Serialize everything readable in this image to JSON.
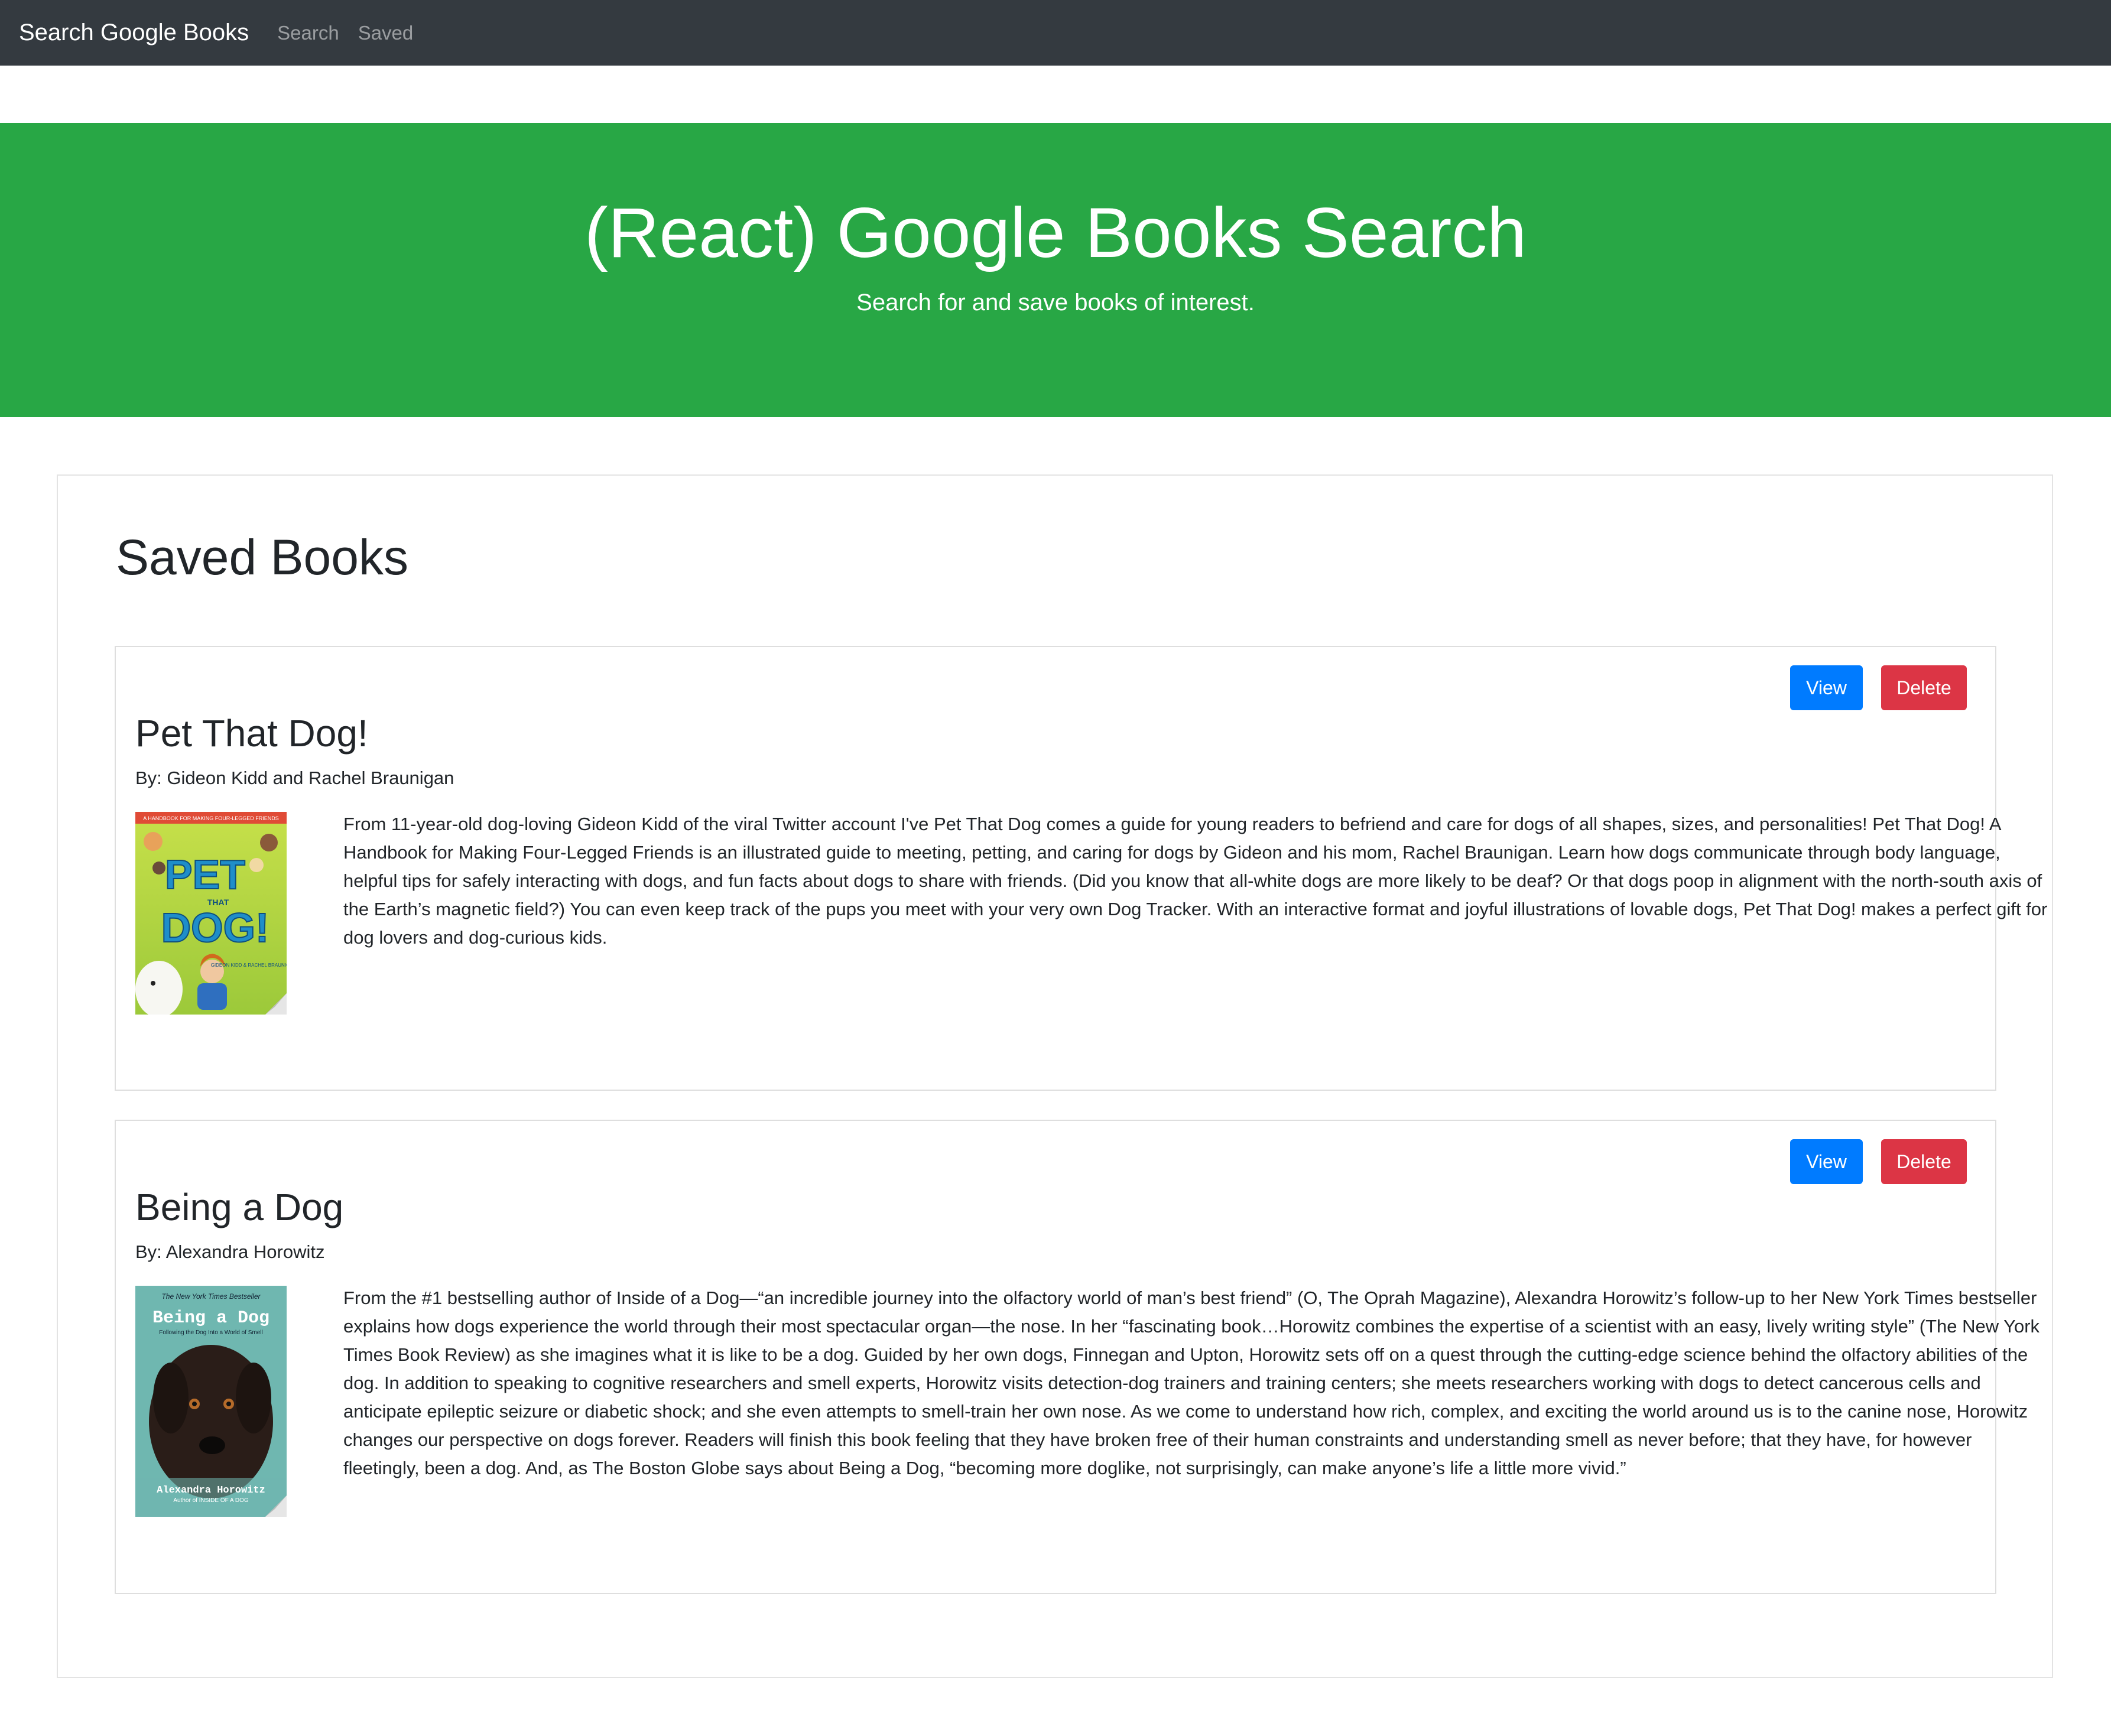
{
  "navbar": {
    "brand": "Search Google Books",
    "links": [
      "Search",
      "Saved"
    ]
  },
  "hero": {
    "title": "(React) Google Books Search",
    "subtitle": "Search for and save books of interest."
  },
  "saved": {
    "heading": "Saved Books",
    "view_label": "View",
    "delete_label": "Delete",
    "books": [
      {
        "title": "Pet That Dog!",
        "authors": "By: Gideon Kidd and Rachel Braunigan",
        "description": "From 11-year-old dog-loving Gideon Kidd of the viral Twitter account I've Pet That Dog comes a guide for young readers to befriend and care for dogs of all shapes, sizes, and personalities! Pet That Dog! A Handbook for Making Four-Legged Friends is an illustrated guide to meeting, petting, and caring for dogs by Gideon and his mom, Rachel Braunigan. Learn how dogs communicate through body language, helpful tips for safely interacting with dogs, and fun facts about dogs to share with friends. (Did you know that all-white dogs are more likely to be deaf? Or that dogs poop in alignment with the north-south axis of the Earth’s magnetic field?) You can even keep track of the pups you meet with your very own Dog Tracker. With an interactive format and joyful illustrations of lovable dogs, Pet That Dog! makes a perfect gift for dog lovers and dog-curious kids.",
        "cover": {
          "top_text": "A HANDBOOK FOR MAKING FOUR-LEGGED FRIENDS",
          "line1": "PET",
          "line2": "THAT",
          "line3": "DOG!",
          "byline": "GIDEON KIDD & RACHEL BRAUNIGAN"
        }
      },
      {
        "title": "Being a Dog",
        "authors": "By: Alexandra Horowitz",
        "description": "From the #1 bestselling author of Inside of a Dog—“an incredible journey into the olfactory world of man’s best friend” (O, The Oprah Magazine), Alexandra Horowitz’s follow-up to her New York Times bestseller explains how dogs experience the world through their most spectacular organ—the nose. In her “fascinating book…Horowitz combines the expertise of a scientist with an easy, lively writing style” (The New York Times Book Review) as she imagines what it is like to be a dog. Guided by her own dogs, Finnegan and Upton, Horowitz sets off on a quest through the cutting-edge science behind the olfactory abilities of the dog. In addition to speaking to cognitive researchers and smell experts, Horowitz visits detection-dog trainers and training centers; she meets researchers working with dogs to detect cancerous cells and anticipate epileptic seizure or diabetic shock; and she even attempts to smell-train her own nose. As we come to understand how rich, complex, and exciting the world around us is to the canine nose, Horowitz changes our perspective on dogs forever. Readers will finish this book feeling that they have broken free of their human constraints and understanding smell as never before; that they have, for however fleetingly, been a dog. And, as The Boston Globe says about Being a Dog, “becoming more doglike, not surprisingly, can make anyone’s life a little more vivid.”",
        "cover": {
          "top_text": "The New York Times Bestseller",
          "title": "Being a Dog",
          "subtitle": "Following the Dog Into a World of Smell",
          "author": "Alexandra Horowitz",
          "author_note": "Author of INSIDE OF A DOG"
        }
      }
    ]
  }
}
